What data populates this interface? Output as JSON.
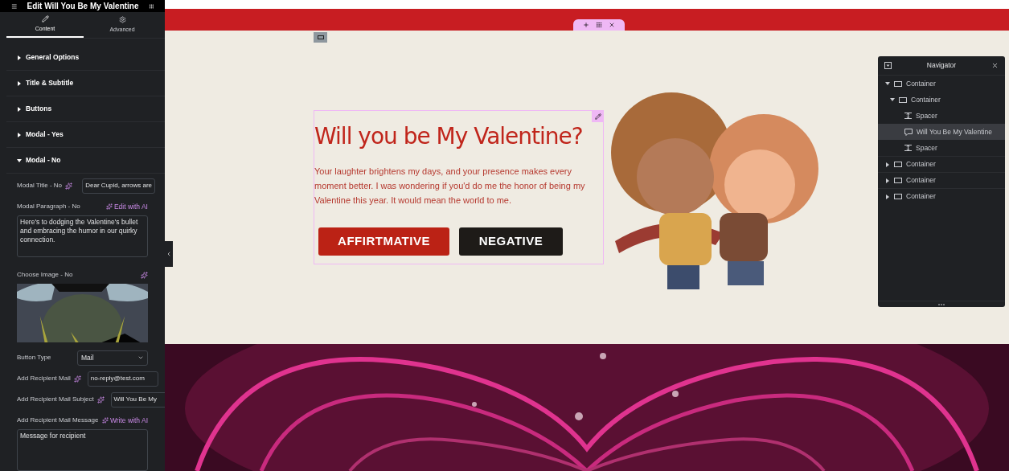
{
  "panel": {
    "title": "Edit Will You Be My Valentine",
    "tabs": [
      {
        "label": "Content",
        "kind": "pencil",
        "selected": true
      },
      {
        "label": "Advanced",
        "kind": "gear",
        "selected": false
      }
    ],
    "sections": [
      {
        "label": "General Options",
        "expanded": false
      },
      {
        "label": "Title & Subtitle",
        "expanded": false
      },
      {
        "label": "Buttons",
        "expanded": false
      },
      {
        "label": "Modal - Yes",
        "expanded": false
      },
      {
        "label": "Modal - No",
        "expanded": true
      }
    ],
    "fields": [
      {
        "kind": "text",
        "label": "Modal Title - No",
        "ai": true,
        "value": "Dear Cupid, arrows are"
      },
      {
        "kind": "textarea",
        "label": "Modal Paragraph - No",
        "ai_link": "Edit with AI",
        "value": "Here's to dodging the Valentine's bullet and embracing the humor in our quirky connection."
      },
      {
        "label": "Choose Image - No",
        "ai": true
      },
      {
        "kind": "select",
        "label": "Button Type",
        "value": "Mail"
      },
      {
        "kind": "text",
        "label": "Add Recipient Mail",
        "ai": true,
        "value": "no-reply@test.com"
      },
      {
        "kind": "text",
        "label": "Add Recipient Mail Subject",
        "ai": true,
        "value": "Will You Be My"
      },
      {
        "kind": "textarea",
        "label": "Add Recipient Mail Message",
        "ai_link": "Write with AI",
        "placeholder": "Message for recipient"
      }
    ]
  },
  "canvas": {
    "title": "Will you be My Valentine?",
    "paragraph": "Your laughter brightens my days, and your presence makes every moment better. I was wondering if you'd do me the honor of being my Valentine this year. It would mean the world to me.",
    "buttons": [
      {
        "label": "AFFIRTMATIVE",
        "kind": "primary"
      },
      {
        "label": "NEGATIVE",
        "kind": "dark"
      }
    ]
  },
  "navigator": {
    "title": "Navigator",
    "items": [
      {
        "label": "Container",
        "kind": "container",
        "expanded": true,
        "selected": false,
        "children": [
          {
            "label": "Container",
            "kind": "container",
            "expanded": true,
            "selected": false,
            "children": [
              {
                "label": "Spacer",
                "kind": "spacer",
                "selected": false
              },
              {
                "label": "Will You Be My Valentine",
                "kind": "widget",
                "selected": true
              },
              {
                "label": "Spacer",
                "kind": "spacer",
                "selected": false
              }
            ]
          }
        ]
      },
      {
        "label": "Container",
        "kind": "container",
        "expanded": false,
        "selected": false
      },
      {
        "label": "Container",
        "kind": "container",
        "expanded": false,
        "selected": false
      },
      {
        "label": "Container",
        "kind": "container",
        "expanded": false,
        "selected": false
      }
    ]
  }
}
